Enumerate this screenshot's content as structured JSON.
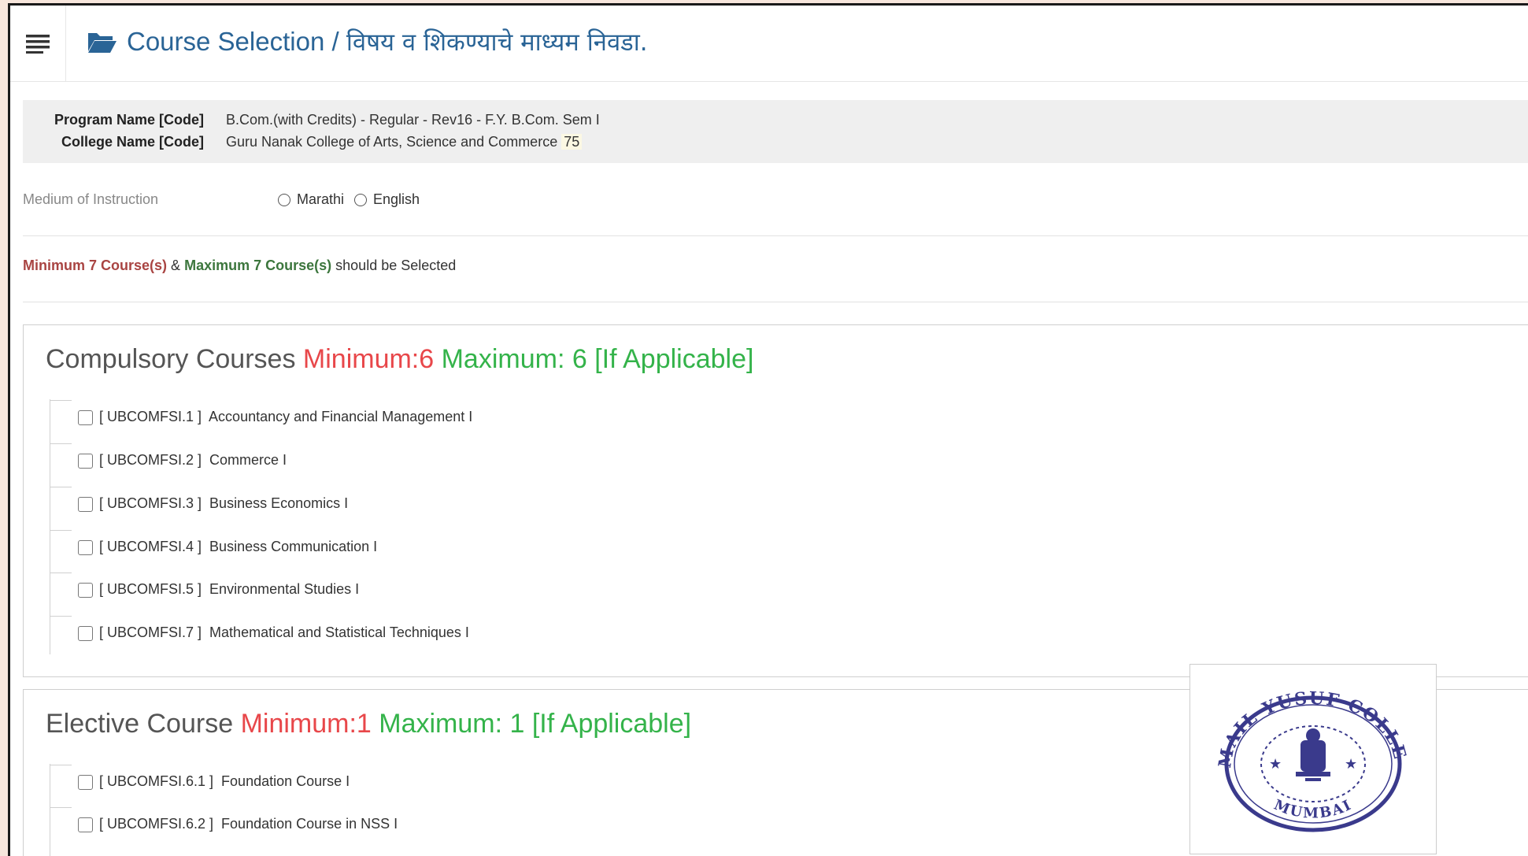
{
  "header": {
    "title_en": "Course Selection / ",
    "title_mr": "विषय व शिकण्याचे माध्यम निवडा."
  },
  "program": {
    "label": "Program Name [Code]",
    "value": "B.Com.(with Credits) - Regular - Rev16 - F.Y. B.Com. Sem I"
  },
  "college": {
    "label": "College Name [Code]",
    "value": "Guru Nanak College of Arts, Science and Commerce",
    "code": "75"
  },
  "medium": {
    "label": "Medium of Instruction",
    "options": [
      "Marathi",
      "English"
    ]
  },
  "rule": {
    "min_text": "Minimum 7 Course(s)",
    "amp": "&",
    "max_text": "Maximum 7 Course(s)",
    "suffix": "should be Selected"
  },
  "compulsory": {
    "title": "Compulsory Courses",
    "min": "Minimum:6",
    "max": "Maximum: 6 [If Applicable]",
    "courses": [
      {
        "code": "[ UBCOMFSI.1 ]",
        "name": "Accountancy and Financial Management I"
      },
      {
        "code": "[ UBCOMFSI.2 ]",
        "name": "Commerce I"
      },
      {
        "code": "[ UBCOMFSI.3 ]",
        "name": "Business Economics I"
      },
      {
        "code": "[ UBCOMFSI.4 ]",
        "name": "Business Communication I"
      },
      {
        "code": "[ UBCOMFSI.5 ]",
        "name": "Environmental Studies I"
      },
      {
        "code": "[ UBCOMFSI.7 ]",
        "name": "Mathematical and Statistical Techniques I"
      }
    ]
  },
  "elective": {
    "title": "Elective Course",
    "min": "Minimum:1",
    "max": "Maximum: 1 [If Applicable]",
    "courses": [
      {
        "code": "[ UBCOMFSI.6.1 ]",
        "name": "Foundation Course I"
      },
      {
        "code": "[ UBCOMFSI.6.2 ]",
        "name": "Foundation Course in NSS I"
      }
    ]
  },
  "seal": {
    "text_top": "ISMAIL YUSUF COLLEGE",
    "text_bottom": "MUMBAI"
  },
  "colors": {
    "title_blue": "#2a6496",
    "min_red": "#e8474a",
    "max_green": "#34b34a"
  }
}
